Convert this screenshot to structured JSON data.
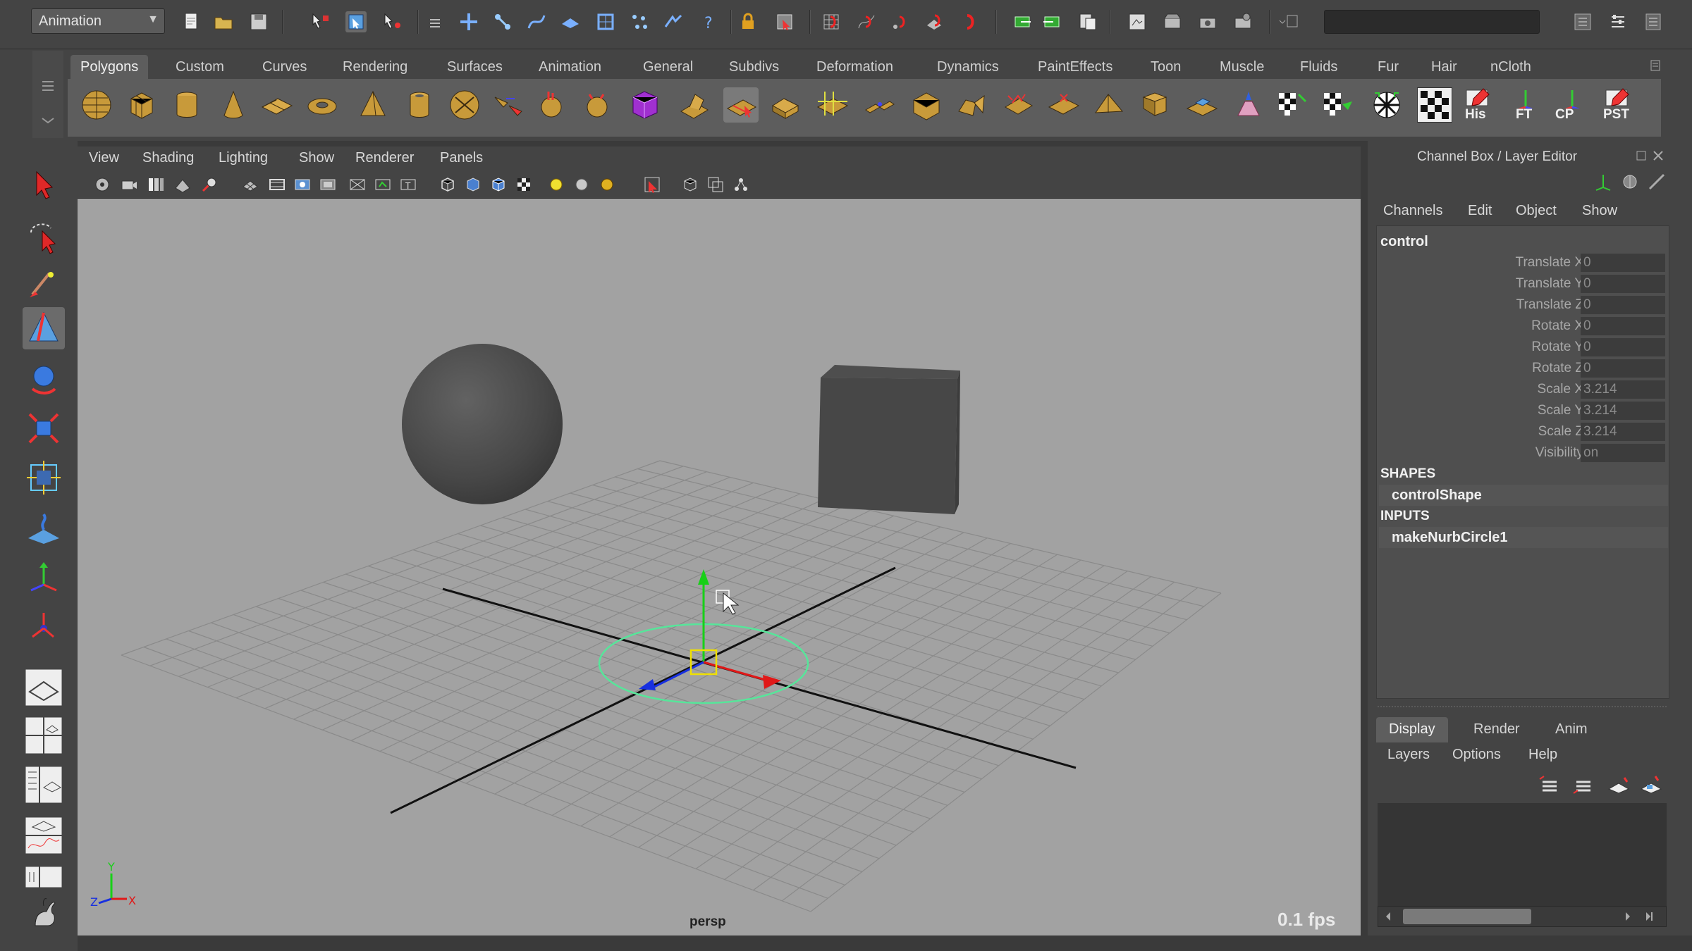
{
  "status_line": {
    "menu_set": "Animation"
  },
  "shelf": {
    "tabs": [
      "Polygons",
      "Custom",
      "Curves",
      "Rendering",
      "Surfaces",
      "Animation",
      "General",
      "Subdivs",
      "Deformation",
      "Dynamics",
      "PaintEffects",
      "Toon",
      "Muscle",
      "Fluids",
      "Fur",
      "Hair",
      "nCloth"
    ],
    "active_tab": "Polygons",
    "labeled_buttons": [
      "His",
      "FT",
      "CP",
      "PST"
    ]
  },
  "viewport": {
    "menus": [
      "View",
      "Shading",
      "Lighting",
      "Show",
      "Renderer",
      "Panels"
    ],
    "camera_label": "persp",
    "fps": "0.1 fps",
    "axis_labels": {
      "x": "X",
      "y": "Y",
      "z": "Z"
    }
  },
  "channel_box": {
    "title": "Channel Box / Layer Editor",
    "menus": [
      "Channels",
      "Edit",
      "Object",
      "Show"
    ],
    "node_name": "control",
    "attributes": [
      {
        "label": "Translate X",
        "value": "0"
      },
      {
        "label": "Translate Y",
        "value": "0"
      },
      {
        "label": "Translate Z",
        "value": "0"
      },
      {
        "label": "Rotate X",
        "value": "0"
      },
      {
        "label": "Rotate Y",
        "value": "0"
      },
      {
        "label": "Rotate Z",
        "value": "0"
      },
      {
        "label": "Scale X",
        "value": "3.214"
      },
      {
        "label": "Scale Y",
        "value": "3.214"
      },
      {
        "label": "Scale Z",
        "value": "3.214"
      },
      {
        "label": "Visibility",
        "value": "on"
      }
    ],
    "shapes_header": "SHAPES",
    "shape_name": "controlShape",
    "inputs_header": "INPUTS",
    "input_name": "makeNurbCircle1"
  },
  "layer_editor": {
    "tabs": [
      "Display",
      "Render",
      "Anim"
    ],
    "active_tab": "Display",
    "menus": [
      "Layers",
      "Options",
      "Help"
    ]
  },
  "colors": {
    "viewport_bg": "#a2a2a2",
    "grid": "#8a8a8a",
    "axis_x": "#e01818",
    "axis_y": "#18d018",
    "axis_z": "#1830e0",
    "selection_circle": "#56e69a",
    "pivot": "#f0e000"
  }
}
